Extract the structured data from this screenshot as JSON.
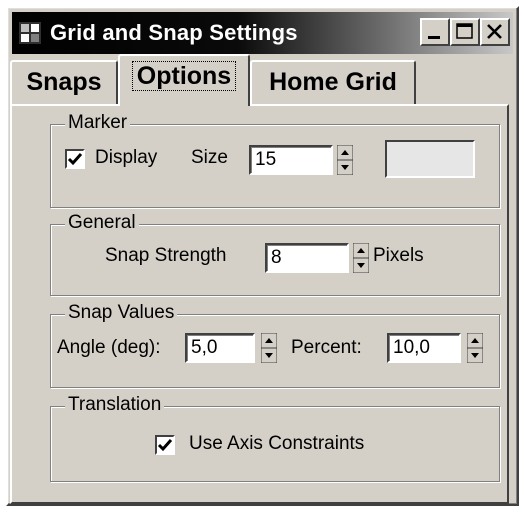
{
  "window": {
    "title": "Grid and Snap Settings",
    "icon": "app-icon",
    "controls": [
      "minimize-icon",
      "maximize-icon",
      "close-icon"
    ]
  },
  "tabs": [
    {
      "label": "Snaps",
      "active": false
    },
    {
      "label": "Options",
      "active": true
    },
    {
      "label": "Home Grid",
      "active": false
    }
  ],
  "marker": {
    "legend": "Marker",
    "display_label": "Display",
    "display_checked": true,
    "size_label": "Size",
    "size_value": "15",
    "swatch_color": "#e6e6e6"
  },
  "general": {
    "legend": "General",
    "snap_strength_label": "Snap Strength",
    "snap_strength_value": "8",
    "pixels_label": "Pixels"
  },
  "snap_values": {
    "legend": "Snap Values",
    "angle_label": "Angle (deg):",
    "angle_value": "5,0",
    "percent_label": "Percent:",
    "percent_value": "10,0"
  },
  "translation": {
    "legend": "Translation",
    "axis_constraints_label": "Use Axis Constraints",
    "axis_constraints_checked": true
  }
}
